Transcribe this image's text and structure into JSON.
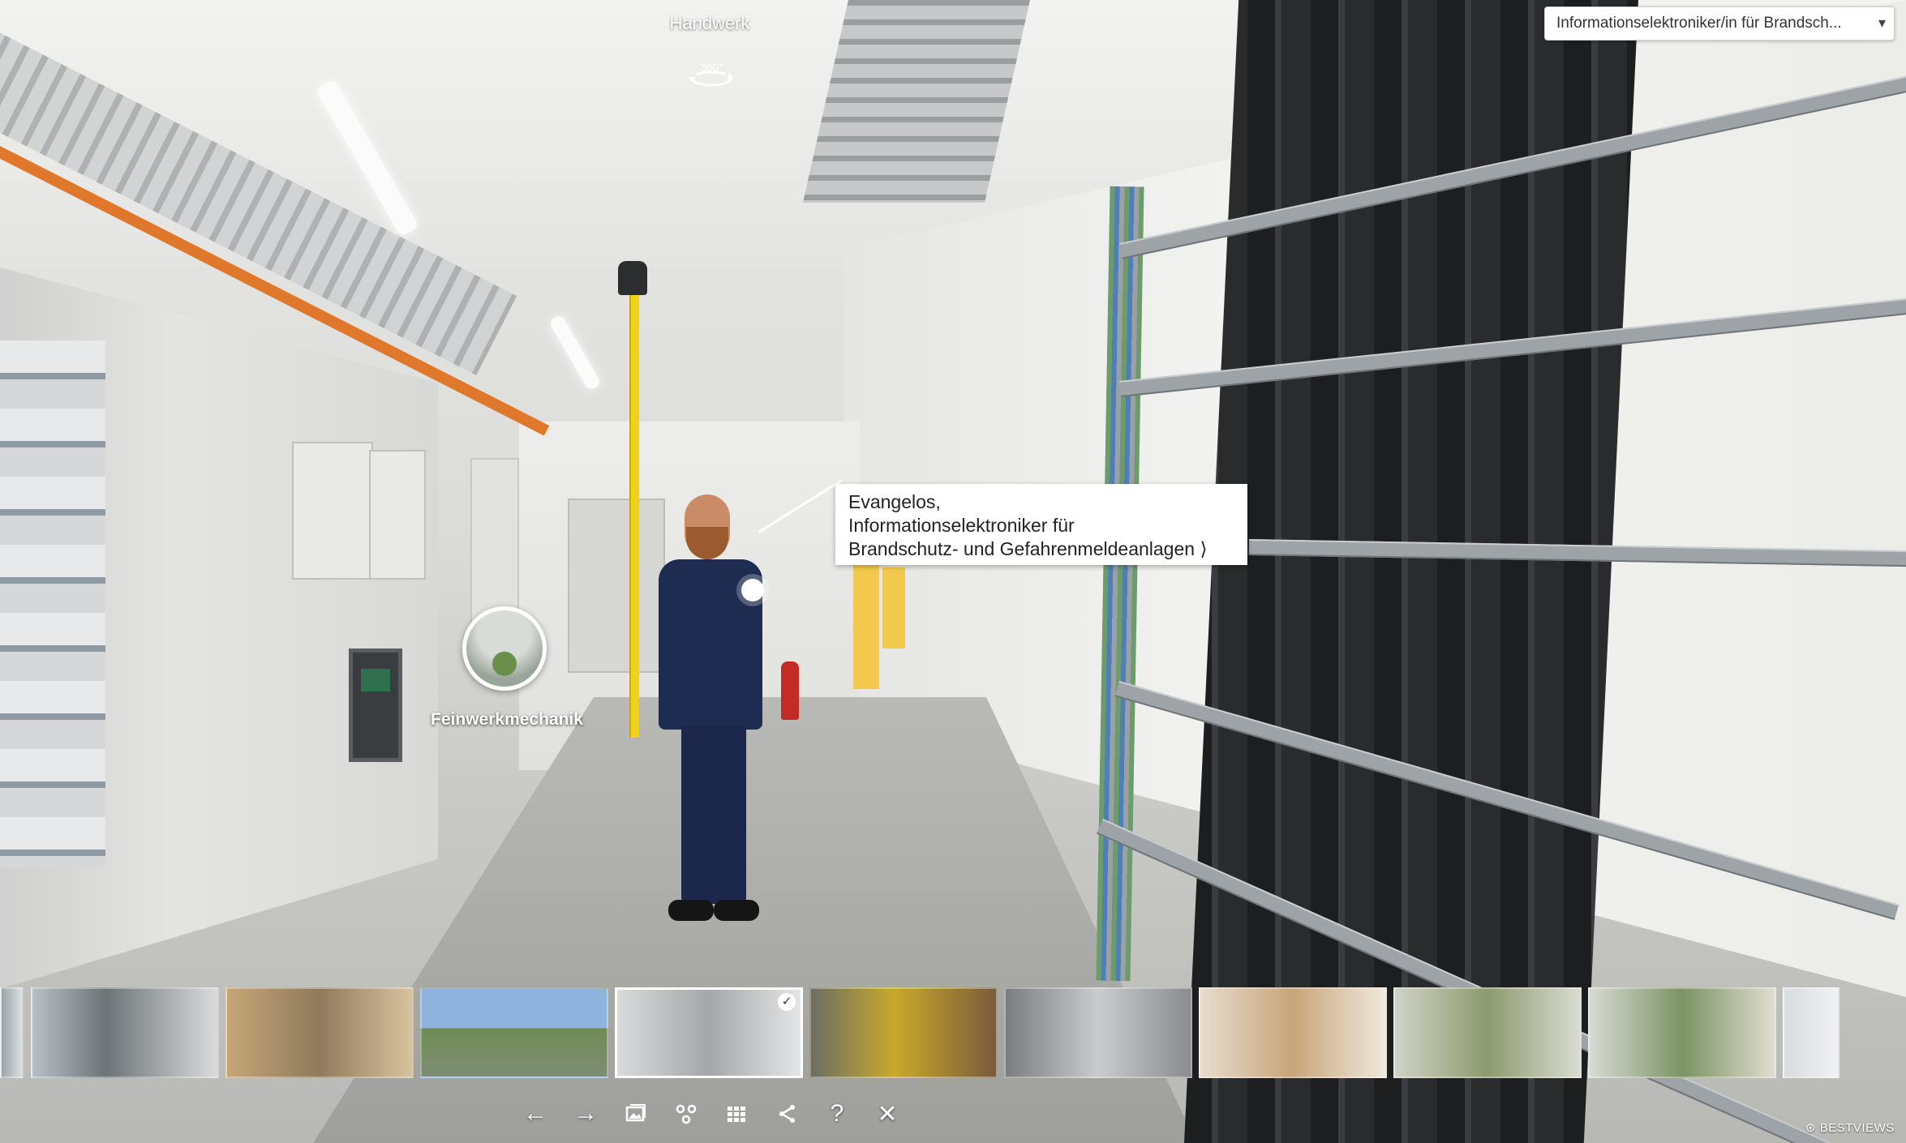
{
  "scene": {
    "title": "Handwerk",
    "view_icon_label": "360°"
  },
  "dropdown": {
    "selected": "Informationselektroniker/in für Brandsch...",
    "arrow_icon": "caret-down-icon"
  },
  "hotspot": {
    "label": "Feinwerkmechanik"
  },
  "info": {
    "line1": "Evangelos,",
    "line2": "Informationselektroniker für",
    "line3": "Brandschutz- und Gefahrenmeldeanlagen ⟩"
  },
  "thumbnails": [
    {
      "name": "thumb-partial",
      "bg": "linear-gradient(90deg,#9aa3a8,#dfe2e3)"
    },
    {
      "name": "thumb-server-room",
      "bg": "linear-gradient(90deg,#b7c0c5,#6d7478 40%,#dadcdc)"
    },
    {
      "name": "thumb-warehouse",
      "bg": "linear-gradient(90deg,#c6a677,#8f7a5b 50%,#d8c3a0)"
    },
    {
      "name": "thumb-outdoor",
      "bg": "linear-gradient(180deg,#8eb4dd 0 45%,#6f8c54 45%,#7e8d73)"
    },
    {
      "name": "thumb-current-room",
      "bg": "linear-gradient(90deg,#d9dadb,#a4a7a9 50%,#e4e5e6)"
    },
    {
      "name": "thumb-workshop-yellow",
      "bg": "linear-gradient(90deg,#6b6e63,#c8a92a 45%,#7a5b3b)"
    },
    {
      "name": "thumb-tunnel",
      "bg": "linear-gradient(90deg,#7a7d80,#c9cbcc 50%,#8a8d90)"
    },
    {
      "name": "thumb-bright-hall",
      "bg": "linear-gradient(90deg,#e6dccd,#c9a57a 50%,#efe8dc)"
    },
    {
      "name": "thumb-lab",
      "bg": "linear-gradient(90deg,#cfd3c6,#8d9a6e 50%,#d9dcd2)"
    },
    {
      "name": "thumb-workshop-green",
      "bg": "linear-gradient(90deg,#d7dbd4,#7c9364 50%,#e0ddd0)"
    },
    {
      "name": "thumb-partial-end",
      "bg": "linear-gradient(90deg,#d8dcdf,#f0f1f2)"
    }
  ],
  "active_thumbnail_index": 4,
  "active_check": "✓",
  "toolbar": [
    {
      "name": "back-arrow-icon",
      "glyph": "←"
    },
    {
      "name": "forward-arrow-icon",
      "glyph": "→"
    },
    {
      "name": "gallery-icon",
      "glyph": ""
    },
    {
      "name": "hotspots-icon",
      "glyph": ""
    },
    {
      "name": "grid-icon",
      "glyph": ""
    },
    {
      "name": "share-icon",
      "glyph": ""
    },
    {
      "name": "help-icon",
      "glyph": "?"
    },
    {
      "name": "close-icon",
      "glyph": "✕"
    }
  ],
  "brand": "⊛ BESTVIEWS"
}
